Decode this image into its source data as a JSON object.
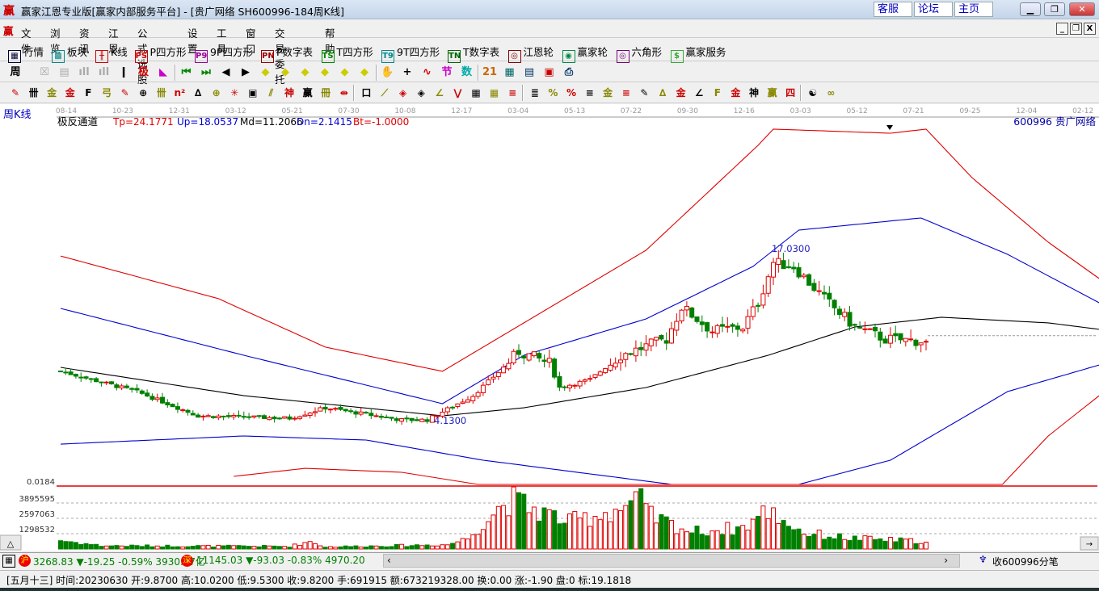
{
  "title": {
    "logo": "赢",
    "text": "赢家江恩专业版[赢家内部服务平台] - [贵广网络  SH600996-184周K线]",
    "buttons": [
      "客服",
      "论坛",
      "主页"
    ]
  },
  "menu": {
    "logo": "赢",
    "items": [
      "文件",
      "浏览",
      "资讯",
      "江恩",
      "公式选股",
      "设置",
      "工具",
      "窗口",
      "交易委托",
      "帮助"
    ]
  },
  "toolbar1": [
    {
      "label": "行情",
      "glyph": "▦",
      "color": "#003"
    },
    {
      "label": "板块",
      "glyph": "▩",
      "color": "#088"
    },
    {
      "label": "K线",
      "glyph": "╫",
      "color": "#c00"
    },
    {
      "label": "P四方形",
      "glyph": "PS",
      "color": "#c00"
    },
    {
      "label": "9P四方形",
      "glyph": "P9",
      "color": "#909"
    },
    {
      "label": "P数字表",
      "glyph": "PN",
      "color": "#900"
    },
    {
      "label": "T四方形",
      "glyph": "TS",
      "color": "#080"
    },
    {
      "label": "9T四方形",
      "glyph": "T9",
      "color": "#088"
    },
    {
      "label": "T数字表",
      "glyph": "TN",
      "color": "#060"
    },
    {
      "label": "江恩轮",
      "glyph": "◎",
      "color": "#800"
    },
    {
      "label": "赢家轮",
      "glyph": "◉",
      "color": "#084"
    },
    {
      "label": "六角形",
      "glyph": "◎",
      "color": "#707"
    },
    {
      "label": "赢家服务",
      "glyph": "$",
      "color": "#3a3"
    }
  ],
  "toolbar2": {
    "period": "周",
    "icons": [
      [
        "pattern",
        "☒",
        "#aaa"
      ],
      [
        "doc",
        "▤",
        "#aaa"
      ],
      [
        "bars3",
        "ıll",
        "#aaa"
      ],
      [
        "bars9",
        "ıll",
        "#aaa"
      ],
      [
        "candle",
        "ǀ",
        "#000"
      ],
      [
        "extreme",
        "极",
        "#c00"
      ],
      [
        "fan",
        "◣",
        "#c0c"
      ],
      [
        "first",
        "⏮",
        "#080"
      ],
      [
        "last",
        "⏭",
        "#080"
      ],
      [
        "left",
        "◀",
        "#000"
      ],
      [
        "right",
        "▶",
        "#000"
      ],
      [
        "move-left",
        "◆",
        "#cc0"
      ],
      [
        "move-right",
        "◆",
        "#cc0"
      ],
      [
        "expand",
        "◆",
        "#cc0"
      ],
      [
        "shrink",
        "◆",
        "#cc0"
      ],
      [
        "zoom-v",
        "◆",
        "#cc0"
      ],
      [
        "zoom-all",
        "◆",
        "#cc0"
      ],
      [
        "hand",
        "✋",
        "#000"
      ],
      [
        "cross",
        "+",
        "#000"
      ],
      [
        "line",
        "∿",
        "#c00"
      ],
      [
        "node",
        "节",
        "#c0c"
      ],
      [
        "number",
        "数",
        "#0aa"
      ],
      [
        "calendar",
        "21",
        "#c60"
      ],
      [
        "calculator",
        "▦",
        "#066"
      ],
      [
        "report",
        "▤",
        "#036"
      ],
      [
        "save",
        "▣",
        "#c00"
      ],
      [
        "print",
        "⎙",
        "#036"
      ]
    ]
  },
  "toolbar3": [
    "✎",
    "卌",
    "金",
    "金",
    "F",
    "弓",
    "✎",
    "⊕",
    "卌",
    "n²",
    "∆",
    "⊕",
    "✳",
    "▣",
    "⫽",
    "神",
    "赢",
    "冊",
    "⇹",
    "口",
    "⟋",
    "◈",
    "◈",
    "∠",
    "⋁",
    "▦",
    "▦",
    "≡",
    "≣",
    "%",
    "%",
    "≡",
    "金",
    "≡",
    "✎",
    "∆",
    "金",
    "∠",
    "F",
    "金",
    "神",
    "赢",
    "四",
    "☯",
    "∞"
  ],
  "chart": {
    "period_label": "周K线",
    "indicator_name": "极反通道",
    "params": [
      {
        "text": "Tp=24.1771",
        "color": "#e00000"
      },
      {
        "text": "Up=18.0537",
        "color": "#0000d0"
      },
      {
        "text": "Md=11.2066",
        "color": "#000000"
      },
      {
        "text": "Dn=2.1415",
        "color": "#0000d0"
      },
      {
        "text": "Bt=-1.0000",
        "color": "#e00000"
      }
    ],
    "stock_label": "600996  贵广网络",
    "date_ticks": [
      "08-14",
      "10-23",
      "12-31",
      "03-12",
      "05-21",
      "07-30",
      "10-08",
      "12-17",
      "03-04",
      "05-13",
      "07-22",
      "09-30",
      "12-16",
      "03-03",
      "05-12",
      "07-21",
      "09-25",
      "12-04",
      "02-12"
    ],
    "high_label": "17.0300",
    "low_label": "4.1300",
    "volume_ticks": [
      "0.0184",
      "3895595",
      "2597063",
      "1298532"
    ],
    "colors": {
      "up": "#e00000",
      "down": "#008000",
      "upper": "#e00000",
      "band": "#0000d0",
      "mid": "#000000"
    }
  },
  "chart_data": {
    "type": "candlestick",
    "title": "贵广网络 SH600996 周K线 极反通道",
    "candle_count": 171,
    "close_keypoints": [
      [
        0,
        7.7
      ],
      [
        15,
        6.25
      ],
      [
        27,
        4.53
      ],
      [
        45,
        4.36
      ],
      [
        52,
        5.1
      ],
      [
        67,
        4.24
      ],
      [
        72,
        4.24
      ],
      [
        81,
        5.96
      ],
      [
        87,
        7.97
      ],
      [
        90,
        9.1
      ],
      [
        96,
        8.26
      ],
      [
        98,
        6.54
      ],
      [
        104,
        7.1
      ],
      [
        110,
        8.83
      ],
      [
        119,
        9.98
      ],
      [
        122,
        12.27
      ],
      [
        128,
        10.55
      ],
      [
        134,
        10.84
      ],
      [
        137,
        12.56
      ],
      [
        140,
        15.43
      ],
      [
        144,
        15.14
      ],
      [
        150,
        12.85
      ],
      [
        156,
        10.84
      ],
      [
        162,
        9.98
      ],
      [
        170,
        9.82
      ]
    ],
    "channels": {
      "tp": [
        [
          0,
          15.88
        ],
        [
          31,
          12.85
        ],
        [
          52,
          9.41
        ],
        [
          75,
          7.69
        ],
        [
          91,
          11.13
        ],
        [
          115,
          16.29
        ],
        [
          137,
          23.74
        ],
        [
          140,
          24.89
        ],
        [
          163,
          24.6
        ],
        [
          170,
          24.89
        ],
        [
          179,
          21.45
        ],
        [
          194,
          16.86
        ],
        [
          204,
          14.28
        ]
      ],
      "up": [
        [
          0,
          12.16
        ],
        [
          36,
          8.83
        ],
        [
          75,
          5.39
        ],
        [
          91,
          8.83
        ],
        [
          115,
          11.41
        ],
        [
          136,
          15.14
        ],
        [
          145,
          17.72
        ],
        [
          169,
          18.58
        ],
        [
          186,
          16.0
        ],
        [
          204,
          12.56
        ]
      ],
      "md": [
        [
          0,
          7.97
        ],
        [
          36,
          5.96
        ],
        [
          75,
          4.53
        ],
        [
          91,
          5.1
        ],
        [
          115,
          6.54
        ],
        [
          139,
          8.83
        ],
        [
          156,
          10.84
        ],
        [
          173,
          11.53
        ],
        [
          194,
          11.13
        ],
        [
          204,
          10.67
        ]
      ],
      "dn": [
        [
          0,
          2.52
        ],
        [
          36,
          3.1
        ],
        [
          60,
          2.81
        ],
        [
          83,
          1.38
        ],
        [
          120,
          -0.34
        ],
        [
          145,
          -0.34
        ],
        [
          163,
          1.38
        ],
        [
          186,
          6.25
        ],
        [
          204,
          8.14
        ]
      ],
      "bt": [
        [
          34,
          0.23
        ],
        [
          48,
          0.8
        ],
        [
          67,
          0.52
        ],
        [
          82,
          -0.34
        ],
        [
          185,
          -0.34
        ],
        [
          194,
          3.1
        ],
        [
          204,
          5.96
        ]
      ]
    },
    "volume_envelope_millions": [
      [
        0,
        0.8
      ],
      [
        8,
        0.3
      ],
      [
        45,
        0.25
      ],
      [
        49,
        0.7
      ],
      [
        52,
        0.2
      ],
      [
        76,
        0.4
      ],
      [
        80,
        1.0
      ],
      [
        83,
        2.5
      ],
      [
        88,
        4.6
      ],
      [
        100,
        2.5
      ],
      [
        110,
        3.8
      ],
      [
        114,
        4.4
      ],
      [
        116,
        3.0
      ],
      [
        124,
        1.6
      ],
      [
        134,
        2.0
      ],
      [
        139,
        3.6
      ],
      [
        146,
        1.5
      ],
      [
        155,
        1.0
      ],
      [
        170,
        0.7
      ]
    ],
    "ylim": [
      -0.34,
      25.5
    ],
    "last_price": 9.82
  },
  "indices": {
    "sh_badge": "沪",
    "sh": "3268.83 ▼-19.25 -0.59% 3930.57亿",
    "sz_badge": "深",
    "sz": "11145.03 ▼-93.03 -0.83% 4970.20",
    "tick_label": "收600996分笔"
  },
  "status": "[五月十三] 时间:20230630 开:9.8700 高:10.0200 低:9.5300 收:9.8200 手:691915 额:673219328.00 换:0.00 涨:-1.90 盘:0 标:19.1818"
}
